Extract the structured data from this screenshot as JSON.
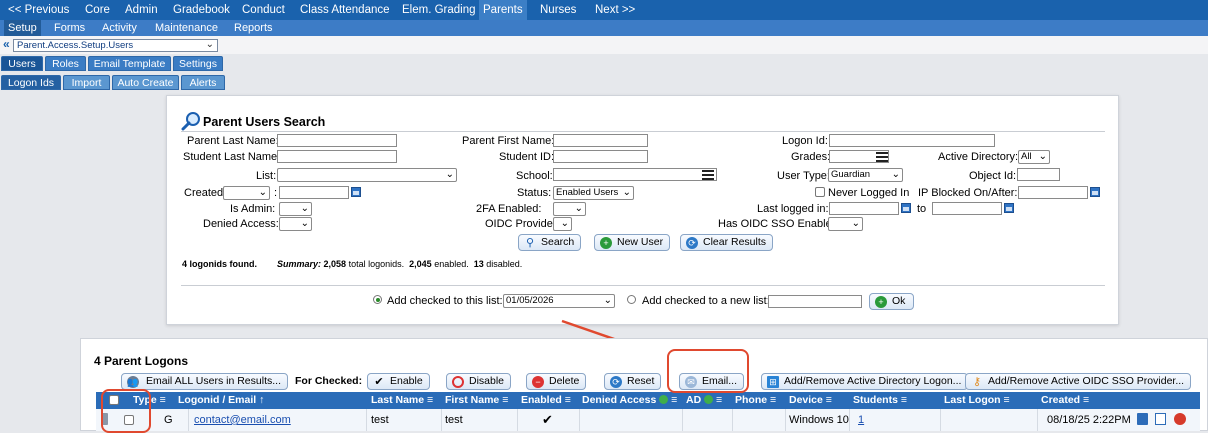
{
  "topnav": [
    "<< Previous",
    "Core",
    "Admin",
    "Gradebook",
    "Conduct",
    "Class Attendance",
    "Elem. Grading",
    "Parents",
    "Nurses",
    "Next >>"
  ],
  "subnav": [
    "Setup",
    "Forms",
    "Activity",
    "Maintenance",
    "Reports"
  ],
  "path_select": "Parent.Access.Setup.Users",
  "tabs": [
    "Users",
    "Roles",
    "Email Template",
    "Settings"
  ],
  "subtabs": [
    "Logon Ids",
    "Import",
    "Auto Create",
    "Alerts"
  ],
  "search": {
    "title": "Parent Users Search",
    "parent_last_name": "Parent Last Name:",
    "parent_first_name": "Parent First Name:",
    "logon_id": "Logon Id:",
    "student_last_name": "Student Last Name:",
    "student_id": "Student ID:",
    "grades": "Grades:",
    "active_directory": "Active Directory:",
    "active_directory_value": "All",
    "list": "List:",
    "school": "School:",
    "user_type": "User Type:",
    "user_type_value": "Guardian",
    "object_id": "Object Id:",
    "created": "Created",
    "colon": ":",
    "status": "Status:",
    "status_value": "Enabled Users",
    "never_logged_in": "Never Logged In",
    "ip_blocked": "IP Blocked On/After:",
    "is_admin": "Is Admin:",
    "twofa": "2FA Enabled:",
    "last_logged_in": "Last logged in:",
    "to": "to",
    "denied_access": "Denied Access:",
    "oidc_provider": "OIDC Provider",
    "has_oidc": "Has OIDC SSO Enabled",
    "search_btn": "Search",
    "new_user_btn": "New User",
    "clear_btn": "Clear Results",
    "found": "4 logonids found.",
    "summary_label": "Summary:",
    "summary_total": "2,058",
    "summary_total_text": "total logonids.",
    "summary_enabled": "2,045",
    "summary_enabled_text": "enabled.",
    "summary_disabled": "13",
    "summary_disabled_text": "disabled.",
    "add_checked": "Add checked to this list:",
    "add_checked_value": "01/05/2026",
    "add_new": "Add checked to a new list:",
    "ok_btn": "Ok"
  },
  "results": {
    "title": "4 Parent Logons",
    "email_all": "Email ALL Users in Results...",
    "for_checked": "For Checked:",
    "enable": "Enable",
    "disable": "Disable",
    "delete": "Delete",
    "reset": "Reset",
    "email": "Email...",
    "add_ad": "Add/Remove Active Directory Logon...",
    "add_oidc": "Add/Remove Active OIDC SSO Provider...",
    "columns": [
      "Type",
      "Logonid / Email ↑",
      "Last Name",
      "First Name",
      "Enabled",
      "Denied Access",
      "AD",
      "Phone",
      "Device",
      "Students",
      "Last Logon",
      "Created"
    ],
    "row": {
      "type": "G",
      "logonid": "contact@email.com",
      "last_name": "test",
      "first_name": "test",
      "enabled": "✔",
      "device": "Windows 10",
      "students": "1",
      "created": "08/18/25 2:22PM"
    }
  },
  "colors": {
    "nav": "#1a62ad",
    "subnav": "#3d7cc6",
    "header": "#2a6cb8",
    "callout": "#e0492f"
  }
}
